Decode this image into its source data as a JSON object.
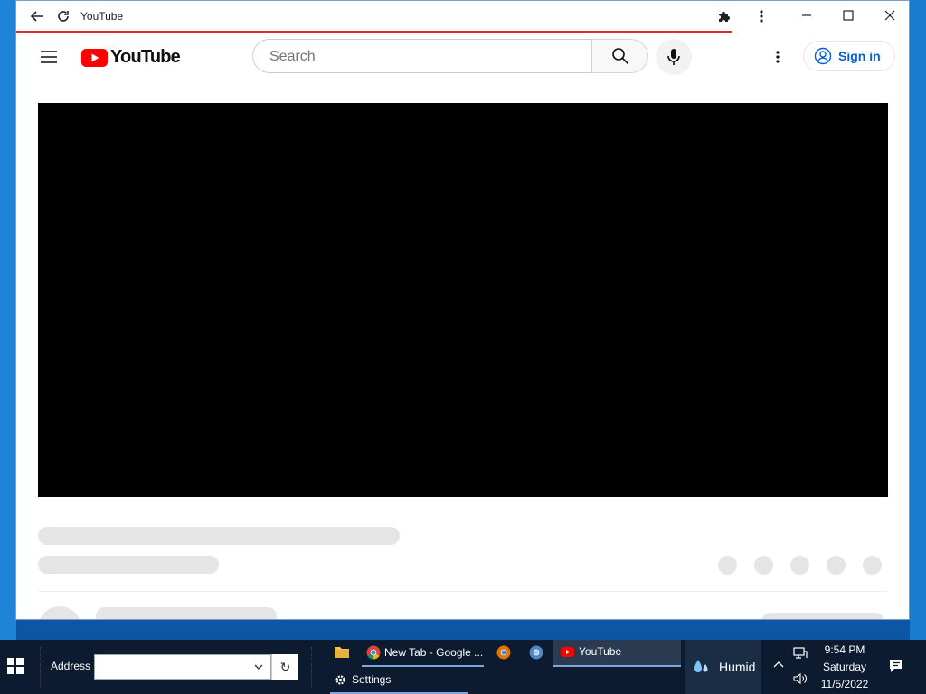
{
  "browser": {
    "tab_title": "YouTube",
    "icons": [
      "back-arrow-icon",
      "reload-icon",
      "extensions-puzzle-icon",
      "kebab-menu-icon",
      "minimize-icon",
      "maximize-icon",
      "close-icon"
    ]
  },
  "youtube": {
    "logo_text": "YouTube",
    "search_placeholder": "Search",
    "signin_label": "Sign in",
    "brand_color": "#ff0000",
    "link_color": "#065fd4"
  },
  "taskbar": {
    "address_label": "Address",
    "address_value": "",
    "apps": [
      {
        "label": "New Tab - Google ...",
        "icon": "chrome-icon"
      },
      {
        "label": "YouTube",
        "icon": "youtube-icon"
      }
    ],
    "settings_label": "Settings",
    "weather_label": "Humid",
    "time": "9:54 PM",
    "day": "Saturday",
    "date": "11/5/2022"
  }
}
